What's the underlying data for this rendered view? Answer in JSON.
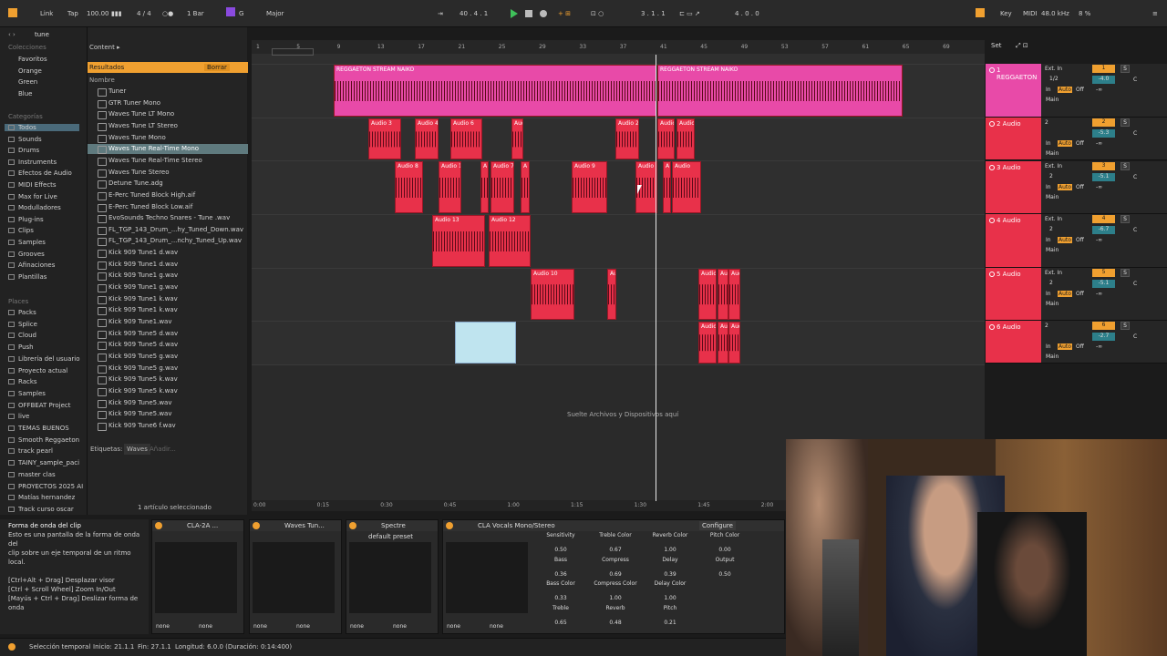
{
  "toolbar": {
    "link": "Link",
    "tap": "Tap",
    "tempo": "100.00",
    "time_sig": "4 / 4",
    "quantize": "1 Bar",
    "key": "G",
    "scale": "Major",
    "position": "40 .  4 .  1",
    "loop_start": "3 .  1 .  1",
    "loop_length": "4 .  0 .  0",
    "key_map": "Key",
    "midi": "MIDI",
    "sample_rate": "48.0 kHz",
    "cpu": "8 %"
  },
  "search": {
    "value": "tune"
  },
  "sidebar": {
    "collections_header": "Colecciones",
    "collections": [
      "Favoritos",
      "Orange",
      "Green",
      "Blue"
    ],
    "collection_colors": [
      "#e8314a",
      "#f08a24",
      "#3fc15a",
      "#4a8ee8"
    ],
    "categories_header": "Categorías",
    "categories": [
      "Todos",
      "Sounds",
      "Drums",
      "Instruments",
      "Efectos de Audio",
      "MIDI Effects",
      "Max for Live",
      "Modulladores",
      "Plug-ins",
      "Clips",
      "Samples",
      "Grooves",
      "Afinaciones",
      "Plantillas"
    ],
    "places_header": "Places",
    "places": [
      "Packs",
      "Splice",
      "Cloud",
      "Push",
      "Librería del usuario",
      "Proyecto actual",
      "Racks",
      "Samples",
      "OFFBEAT Project",
      "live",
      "TEMAS BUENOS",
      "Smooth Reggaeton",
      "track pearl",
      "TAINY_sample_paci",
      "master clas",
      "PROYECTOS 2025 AI",
      "Matías hernandez",
      "Track curso oscar"
    ]
  },
  "browser": {
    "content_label": "Content ▸",
    "results_label": "Resultados",
    "clear_button": "Borrar",
    "name_header": "Nombre",
    "items": [
      "Tuner",
      "GTR Tuner Mono",
      "Waves Tune LT Mono",
      "Waves Tune LT Stereo",
      "Waves Tune Mono",
      "Waves Tune Real-Time Mono",
      "Waves Tune Real-Time Stereo",
      "Waves Tune Stereo",
      "Detune Tune.adg",
      "E-Perc Tuned Block High.aif",
      "E-Perc Tuned Block Low.aif",
      "EvoSounds Techno Snares - Tune .wav",
      "FL_TGP_143_Drum_...hy_Tuned_Down.wav",
      "FL_TGP_143_Drum_...nchy_Tuned_Up.wav",
      "Kick 909 Tune1 d.wav",
      "Kick 909 Tune1 d.wav",
      "Kick 909 Tune1 g.wav",
      "Kick 909 Tune1 g.wav",
      "Kick 909 Tune1 k.wav",
      "Kick 909 Tune1 k.wav",
      "Kick 909 Tune1.wav",
      "Kick 909 Tune5 d.wav",
      "Kick 909 Tune5 d.wav",
      "Kick 909 Tune5 g.wav",
      "Kick 909 Tune5 g.wav",
      "Kick 909 Tune5 k.wav",
      "Kick 909 Tune5 k.wav",
      "Kick 909 Tune5.wav",
      "Kick 909 Tune5.wav",
      "Kick 909 Tune6 f.wav"
    ],
    "selected_index": 5,
    "tags_label": "Etiquetas:",
    "tag": "Waves",
    "add_tag": "Añadir...",
    "footer": "1 artículo seleccionado"
  },
  "ruler": [
    "1",
    "5",
    "9",
    "13",
    "17",
    "21",
    "25",
    "29",
    "33",
    "37",
    "41",
    "45",
    "49",
    "53",
    "57",
    "61",
    "65",
    "69"
  ],
  "time_ruler": [
    "0:00",
    "0:15",
    "0:30",
    "0:45",
    "1:00",
    "1:15",
    "1:30",
    "1:45",
    "2:00"
  ],
  "drop_hint": "Suelte Archivos y Dispositivos aquí",
  "set_label": "Set",
  "tracks": [
    {
      "name": "1 REGGAETON",
      "num": "1",
      "input": "Ext. In",
      "channel": "1/2",
      "vol": "-4.0",
      "pan": "C",
      "color": "#e84aa8",
      "clips": [
        {
          "name": "REGGAETON STREAM NAIKO"
        },
        {
          "name": "REGGAETON STREAM NAIKO"
        }
      ]
    },
    {
      "name": "2 Audio",
      "num": "2",
      "input": "2",
      "channel": "",
      "vol": "-5.3",
      "pan": "C",
      "color": "#e8314a",
      "clips": [
        {
          "name": "Audio 3"
        },
        {
          "name": "Audio 4"
        },
        {
          "name": "Audio 6"
        },
        {
          "name": "Aud"
        },
        {
          "name": "Audio 2"
        },
        {
          "name": "Audio"
        },
        {
          "name": "Audio"
        }
      ]
    },
    {
      "name": "3 Audio",
      "num": "3",
      "input": "Ext. In",
      "channel": "2",
      "vol": "-5.1",
      "pan": "C",
      "color": "#e8314a",
      "clips": [
        {
          "name": "Audio 8"
        },
        {
          "name": "Audio 1"
        },
        {
          "name": "A"
        },
        {
          "name": "Audio 7"
        },
        {
          "name": "A"
        },
        {
          "name": "Audio 9"
        },
        {
          "name": "Audio"
        },
        {
          "name": "A"
        },
        {
          "name": "Audio"
        }
      ]
    },
    {
      "name": "4 Audio",
      "num": "4",
      "input": "Ext. In",
      "channel": "2",
      "vol": "-6.7",
      "pan": "C",
      "color": "#e8314a",
      "clips": [
        {
          "name": "Audio 13"
        },
        {
          "name": "Audio 12"
        }
      ]
    },
    {
      "name": "5 Audio",
      "num": "5",
      "input": "Ext. In",
      "channel": "2",
      "vol": "-5.1",
      "pan": "C",
      "color": "#e8314a",
      "clips": [
        {
          "name": "Audio 10"
        },
        {
          "name": "Au"
        },
        {
          "name": "Audio"
        },
        {
          "name": "Aud"
        },
        {
          "name": "Audio"
        }
      ]
    },
    {
      "name": "6 Audio",
      "num": "6",
      "input": "2",
      "channel": "",
      "vol": "-2.7",
      "pan": "C",
      "color": "#e8314a",
      "clips": [
        {
          "name": ""
        },
        {
          "name": "Audio"
        },
        {
          "name": "Aud"
        },
        {
          "name": "Audio"
        }
      ]
    }
  ],
  "track_labels": {
    "auto": "Auto",
    "off": "Off",
    "in": "In",
    "main": "Main",
    "inf": "-∞",
    "s": "S"
  },
  "info": {
    "title": "Forma de onda del clip",
    "lines": [
      "Esto es una pantalla de la forma de onda del",
      "clip sobre un eje temporal de un ritmo local.",
      "",
      "[Ctrl+Alt + Drag] Desplazar visor",
      "[Ctrl + Scroll Wheel] Zoom In/Out",
      "[Mayús + Ctrl + Drag] Deslizar forma de onda"
    ]
  },
  "devices": [
    {
      "title": "CLA-2A ...",
      "preset": ""
    },
    {
      "title": "Waves Tun...",
      "preset": ""
    },
    {
      "title": "Spectre",
      "preset": "default preset"
    },
    {
      "title": "CLA Vocals Mono/Stereo",
      "preset": ""
    }
  ],
  "device_io": {
    "none": "none"
  },
  "configure": "Configure",
  "params": [
    {
      "name": "Sensitivity",
      "value": "0.50"
    },
    {
      "name": "Treble Color",
      "value": "0.67"
    },
    {
      "name": "Reverb Color",
      "value": "1.00"
    },
    {
      "name": "Pitch Color",
      "value": "0.00"
    },
    {
      "name": "Bass",
      "value": "0.36"
    },
    {
      "name": "Compress",
      "value": "0.69"
    },
    {
      "name": "Delay",
      "value": "0.39"
    },
    {
      "name": "Output",
      "value": "0.50"
    },
    {
      "name": "Bass Color",
      "value": "0.33"
    },
    {
      "name": "Compress Color",
      "value": "1.00"
    },
    {
      "name": "Delay Color",
      "value": "1.00"
    },
    {
      "name": "",
      "value": ""
    },
    {
      "name": "Treble",
      "value": "0.65"
    },
    {
      "name": "Reverb",
      "value": "0.48"
    },
    {
      "name": "Pitch",
      "value": "0.21"
    },
    {
      "name": "",
      "value": ""
    }
  ],
  "status": {
    "selection": "Selección temporal",
    "start": "Inicio: 21.1.1",
    "end": "Fin: 27.1.1",
    "length": "Longitud: 6.0.0 (Duración: 0:14:400)"
  }
}
